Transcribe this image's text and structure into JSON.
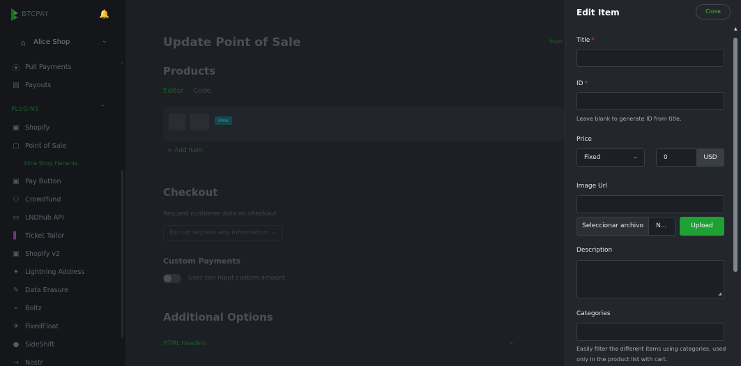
{
  "sidebar": {
    "brand": "BTCPAY",
    "store": "Alice Shop",
    "items_top": [
      {
        "label": "Pull Payments",
        "icon": "pull-payments-icon"
      },
      {
        "label": "Payouts",
        "icon": "payouts-icon"
      }
    ],
    "plugins_heading": "PLUGINS",
    "plugins": [
      {
        "label": "Shopify",
        "icon": "shopify-icon"
      },
      {
        "label": "Point of Sale",
        "icon": "pos-icon"
      },
      {
        "label": "Pay Button",
        "icon": "pay-button-icon"
      },
      {
        "label": "Crowdfund",
        "icon": "crowdfund-icon"
      },
      {
        "label": "LNDhub API",
        "icon": "lndhub-icon"
      },
      {
        "label": "Ticket Tailor",
        "icon": "ticket-tailor-icon"
      },
      {
        "label": "Shopify v2",
        "icon": "shopify-icon"
      },
      {
        "label": "Lightning Address",
        "icon": "lightning-icon"
      },
      {
        "label": "Data Erasure",
        "icon": "data-erasure-icon"
      },
      {
        "label": "Boltz",
        "icon": "boltz-icon"
      },
      {
        "label": "FixedFloat",
        "icon": "fixedfloat-icon"
      },
      {
        "label": "SideShift",
        "icon": "sideshift-icon"
      },
      {
        "label": "Nostr",
        "icon": "nostr-icon"
      }
    ],
    "active_sub": "Alice Shop Hanania"
  },
  "main": {
    "title": "Update Point of Sale",
    "top_link": "Invo",
    "products_heading": "Products",
    "tabs": [
      "Editor",
      "Code"
    ],
    "free_badge": "Free",
    "add_item": "+ Add Item",
    "checkout_heading": "Checkout",
    "request_label": "Request customer data on checkout",
    "request_value": "Do not request any information",
    "custom_payments_heading": "Custom Payments",
    "custom_amount_label": "User can input custom amount",
    "additional_heading": "Additional Options",
    "html_headers": "HTML Headers"
  },
  "panel": {
    "title": "Edit Item",
    "close": "Close",
    "title_label": "Title",
    "title_value": "",
    "id_label": "ID",
    "id_value": "",
    "id_help": "Leave blank to generate ID from title.",
    "price_label": "Price",
    "price_type": "Fixed",
    "price_value": "0",
    "currency": "USD",
    "image_label": "Image Url",
    "image_value": "",
    "file_button": "Seleccionar archivo",
    "file_name": "N...",
    "upload": "Upload",
    "description_label": "Description",
    "categories_label": "Categories",
    "categories_help": "Easily filter the different items using categories, used only in the product list with cart."
  },
  "colors": {
    "accent": "#1fa032",
    "required": "#d9434a",
    "panel_bg": "#23272c"
  }
}
